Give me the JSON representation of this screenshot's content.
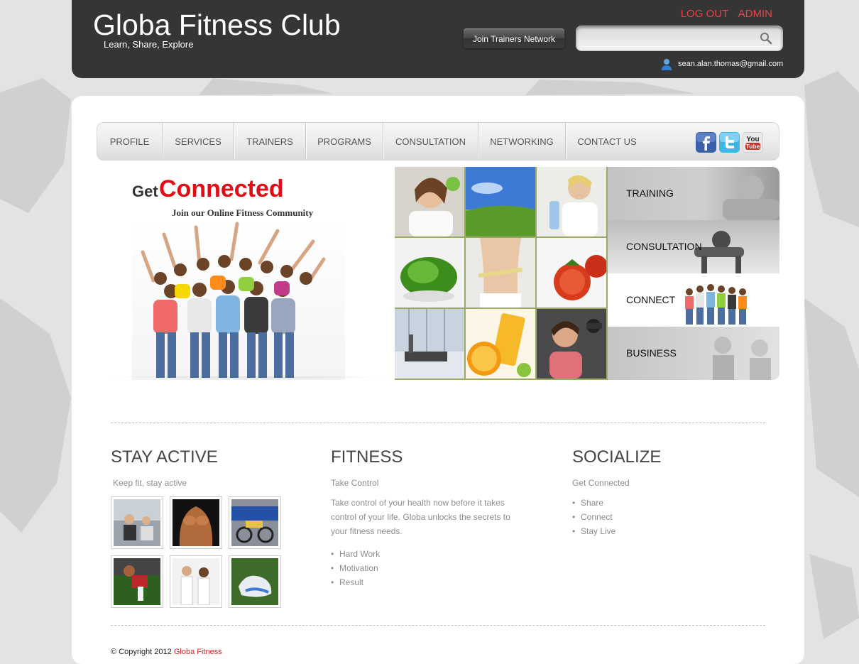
{
  "header": {
    "title": "Globa Fitness Club",
    "tagline": "Learn, Share, Explore",
    "logout_label": "LOG OUT",
    "admin_label": "ADMIN",
    "join_button_label": "Join Trainers Network",
    "search": {
      "value": "",
      "placeholder": ""
    },
    "user_email": "sean.alan.thomas@gmail.com"
  },
  "nav": {
    "items": [
      {
        "label": "PROFILE"
      },
      {
        "label": "SERVICES"
      },
      {
        "label": "TRAINERS"
      },
      {
        "label": "PROGRAMS"
      },
      {
        "label": "CONSULTATION"
      },
      {
        "label": "NETWORKING"
      },
      {
        "label": "CONTACT US"
      }
    ],
    "social": [
      "facebook-icon",
      "twitter-icon",
      "youtube-icon"
    ]
  },
  "banner": {
    "get": "Get",
    "connected": "Connected",
    "subtitle": "Join our Online Fitness Community"
  },
  "side_menu": {
    "items": [
      {
        "label": "TRAINING"
      },
      {
        "label": "CONSULTATION"
      },
      {
        "label": "CONNECT"
      },
      {
        "label": "BUSINESS"
      }
    ]
  },
  "columns": {
    "stay_active": {
      "title": "STAY ACTIVE",
      "subtitle": "Keep fit, stay active"
    },
    "fitness": {
      "title": "FITNESS",
      "subtitle": "Take Control",
      "paragraph": "Take control of your health now before it takes control of your life. Globa unlocks the secrets to your fitness needs.",
      "bullets": [
        "Hard Work",
        "Motivation",
        "Result"
      ]
    },
    "socialize": {
      "title": "SOCIALIZE",
      "subtitle": "Get Connected",
      "bullets": [
        "Share",
        "Connect",
        "Stay Live"
      ]
    }
  },
  "footer": {
    "copyright_prefix": "© Copyright 2012",
    "copyright_brand": "Globa Fitness"
  },
  "colors": {
    "header_bg": "#353535",
    "accent_red": "#e30c14",
    "link_red": "#e8424a"
  }
}
